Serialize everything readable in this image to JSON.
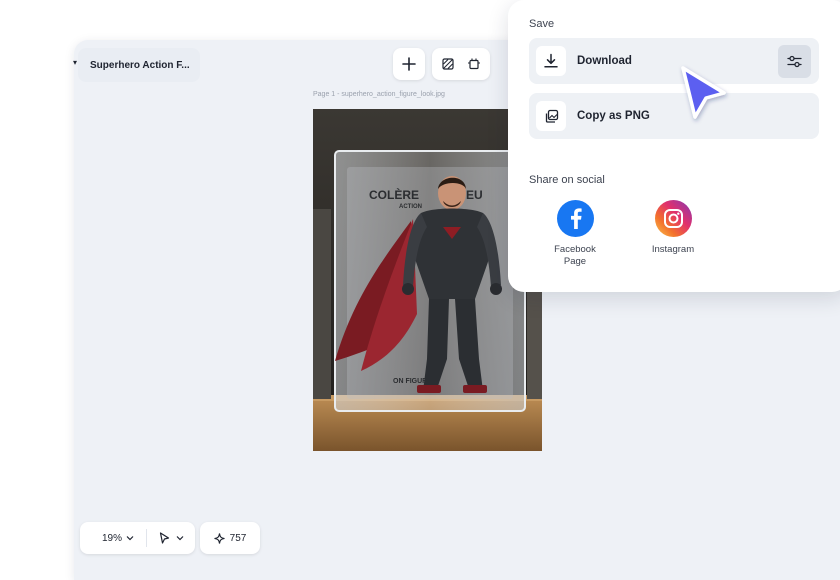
{
  "document": {
    "title": "Superhero Action F..."
  },
  "canvas": {
    "page_caption": "Page 1 -  superhero_action_figure_look.jpg",
    "photo_alt": "superhero_action_figure_look.jpg",
    "box_text_top": "COLÈRE",
    "box_text_top_right": "EU",
    "box_text_sub": "ACTION",
    "box_text_bottom": "ON FIGURE"
  },
  "toolbar": {
    "add_icon": "plus-icon",
    "tool_icons": [
      "crop-icon",
      "resize-icon"
    ]
  },
  "bottom_bar": {
    "zoom": "19%",
    "credits": "757"
  },
  "save_panel": {
    "heading": "Save",
    "download_label": "Download",
    "copy_label": "Copy as PNG",
    "share_heading": "Share on social",
    "social": [
      {
        "label": "Facebook\nPage",
        "icon": "facebook-icon"
      },
      {
        "label": "Instagram",
        "icon": "instagram-icon"
      }
    ]
  },
  "colors": {
    "accent_cursor": "#5b5ef0",
    "facebook": "#1877f2",
    "canvas_bg": "#eef1f6"
  }
}
